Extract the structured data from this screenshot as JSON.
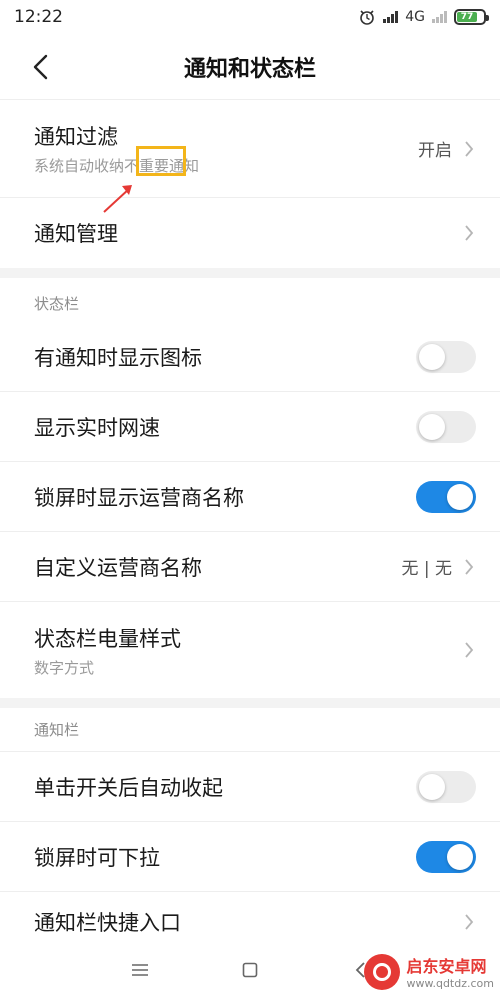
{
  "status_bar": {
    "time": "12:22",
    "network": "4G",
    "battery": "77"
  },
  "header": {
    "title": "通知和状态栏"
  },
  "rows_top": [
    {
      "title": "通知过滤",
      "subtitle": "系统自动收纳不重要通知",
      "value": "开启"
    },
    {
      "title": "通知管理"
    }
  ],
  "section_status": {
    "label": "状态栏",
    "items": [
      {
        "title": "有通知时显示图标",
        "toggle": false
      },
      {
        "title": "显示实时网速",
        "toggle": false
      },
      {
        "title": "锁屏时显示运营商名称",
        "toggle": true
      },
      {
        "title": "自定义运营商名称",
        "value": "无 | 无"
      },
      {
        "title": "状态栏电量样式",
        "subtitle": "数字方式"
      }
    ]
  },
  "section_notify": {
    "label": "通知栏",
    "items": [
      {
        "title": "单击开关后自动收起",
        "toggle": false
      },
      {
        "title": "锁屏时可下拉",
        "toggle": true
      },
      {
        "title": "通知栏快捷入口"
      }
    ]
  },
  "watermark": {
    "name": "启东安卓网",
    "url": "www.qdtdz.com"
  },
  "colors": {
    "toggle_on": "#1e88e5",
    "annotation": "#f3b51a",
    "arrow": "#e53935"
  }
}
